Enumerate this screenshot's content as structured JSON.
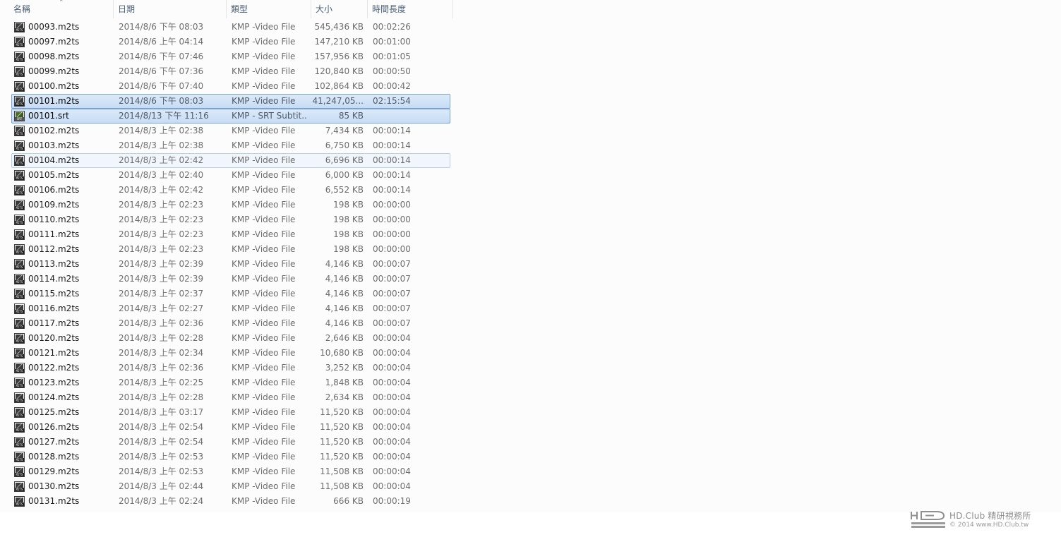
{
  "columns": {
    "name": "名稱",
    "date": "日期",
    "type": "類型",
    "size": "大小",
    "duration": "時間長度"
  },
  "files": [
    {
      "name": "00093.m2ts",
      "date": "2014/8/6 下午 08:03",
      "type": "KMP -Video File",
      "size": "545,436 KB",
      "duration": "00:02:26",
      "icon": "m2ts-file-icon"
    },
    {
      "name": "00097.m2ts",
      "date": "2014/8/6 上午 04:14",
      "type": "KMP -Video File",
      "size": "147,210 KB",
      "duration": "00:01:00",
      "icon": "m2ts-file-icon"
    },
    {
      "name": "00098.m2ts",
      "date": "2014/8/6 下午 07:46",
      "type": "KMP -Video File",
      "size": "157,956 KB",
      "duration": "00:01:05",
      "icon": "m2ts-file-icon"
    },
    {
      "name": "00099.m2ts",
      "date": "2014/8/6 下午 07:36",
      "type": "KMP -Video File",
      "size": "120,840 KB",
      "duration": "00:00:50",
      "icon": "m2ts-file-icon"
    },
    {
      "name": "00100.m2ts",
      "date": "2014/8/6 下午 07:40",
      "type": "KMP -Video File",
      "size": "102,864 KB",
      "duration": "00:00:42",
      "icon": "m2ts-file-icon"
    },
    {
      "name": "00101.m2ts",
      "date": "2014/8/6 下午 08:03",
      "type": "KMP -Video File",
      "size": "41,247,05...",
      "duration": "02:15:54",
      "icon": "m2ts-file-icon",
      "state": "selected"
    },
    {
      "name": "00101.srt",
      "date": "2014/8/13 下午 11:16",
      "type": "KMP - SRT Subtit...",
      "size": "85 KB",
      "duration": "",
      "icon": "srt-file-icon",
      "state": "selected"
    },
    {
      "name": "00102.m2ts",
      "date": "2014/8/3 上午 02:38",
      "type": "KMP -Video File",
      "size": "7,434 KB",
      "duration": "00:00:14",
      "icon": "m2ts-file-icon"
    },
    {
      "name": "00103.m2ts",
      "date": "2014/8/3 上午 02:38",
      "type": "KMP -Video File",
      "size": "6,750 KB",
      "duration": "00:00:14",
      "icon": "m2ts-file-icon"
    },
    {
      "name": "00104.m2ts",
      "date": "2014/8/3 上午 02:42",
      "type": "KMP -Video File",
      "size": "6,696 KB",
      "duration": "00:00:14",
      "icon": "m2ts-file-icon",
      "state": "hover"
    },
    {
      "name": "00105.m2ts",
      "date": "2014/8/3 上午 02:40",
      "type": "KMP -Video File",
      "size": "6,000 KB",
      "duration": "00:00:14",
      "icon": "m2ts-file-icon"
    },
    {
      "name": "00106.m2ts",
      "date": "2014/8/3 上午 02:42",
      "type": "KMP -Video File",
      "size": "6,552 KB",
      "duration": "00:00:14",
      "icon": "m2ts-file-icon"
    },
    {
      "name": "00109.m2ts",
      "date": "2014/8/3 上午 02:23",
      "type": "KMP -Video File",
      "size": "198 KB",
      "duration": "00:00:00",
      "icon": "m2ts-file-icon"
    },
    {
      "name": "00110.m2ts",
      "date": "2014/8/3 上午 02:23",
      "type": "KMP -Video File",
      "size": "198 KB",
      "duration": "00:00:00",
      "icon": "m2ts-file-icon"
    },
    {
      "name": "00111.m2ts",
      "date": "2014/8/3 上午 02:23",
      "type": "KMP -Video File",
      "size": "198 KB",
      "duration": "00:00:00",
      "icon": "m2ts-file-icon"
    },
    {
      "name": "00112.m2ts",
      "date": "2014/8/3 上午 02:23",
      "type": "KMP -Video File",
      "size": "198 KB",
      "duration": "00:00:00",
      "icon": "m2ts-file-icon"
    },
    {
      "name": "00113.m2ts",
      "date": "2014/8/3 上午 02:39",
      "type": "KMP -Video File",
      "size": "4,146 KB",
      "duration": "00:00:07",
      "icon": "m2ts-file-icon"
    },
    {
      "name": "00114.m2ts",
      "date": "2014/8/3 上午 02:39",
      "type": "KMP -Video File",
      "size": "4,146 KB",
      "duration": "00:00:07",
      "icon": "m2ts-file-icon"
    },
    {
      "name": "00115.m2ts",
      "date": "2014/8/3 上午 02:37",
      "type": "KMP -Video File",
      "size": "4,146 KB",
      "duration": "00:00:07",
      "icon": "m2ts-file-icon"
    },
    {
      "name": "00116.m2ts",
      "date": "2014/8/3 上午 02:27",
      "type": "KMP -Video File",
      "size": "4,146 KB",
      "duration": "00:00:07",
      "icon": "m2ts-file-icon"
    },
    {
      "name": "00117.m2ts",
      "date": "2014/8/3 上午 02:36",
      "type": "KMP -Video File",
      "size": "4,146 KB",
      "duration": "00:00:07",
      "icon": "m2ts-file-icon"
    },
    {
      "name": "00120.m2ts",
      "date": "2014/8/3 上午 02:28",
      "type": "KMP -Video File",
      "size": "2,646 KB",
      "duration": "00:00:04",
      "icon": "m2ts-file-icon"
    },
    {
      "name": "00121.m2ts",
      "date": "2014/8/3 上午 02:34",
      "type": "KMP -Video File",
      "size": "10,680 KB",
      "duration": "00:00:04",
      "icon": "m2ts-file-icon"
    },
    {
      "name": "00122.m2ts",
      "date": "2014/8/3 上午 02:36",
      "type": "KMP -Video File",
      "size": "3,252 KB",
      "duration": "00:00:04",
      "icon": "m2ts-file-icon"
    },
    {
      "name": "00123.m2ts",
      "date": "2014/8/3 上午 02:25",
      "type": "KMP -Video File",
      "size": "1,848 KB",
      "duration": "00:00:04",
      "icon": "m2ts-file-icon"
    },
    {
      "name": "00124.m2ts",
      "date": "2014/8/3 上午 02:28",
      "type": "KMP -Video File",
      "size": "2,634 KB",
      "duration": "00:00:04",
      "icon": "m2ts-file-icon"
    },
    {
      "name": "00125.m2ts",
      "date": "2014/8/3 上午 03:17",
      "type": "KMP -Video File",
      "size": "11,520 KB",
      "duration": "00:00:04",
      "icon": "m2ts-file-icon"
    },
    {
      "name": "00126.m2ts",
      "date": "2014/8/3 上午 02:54",
      "type": "KMP -Video File",
      "size": "11,520 KB",
      "duration": "00:00:04",
      "icon": "m2ts-file-icon"
    },
    {
      "name": "00127.m2ts",
      "date": "2014/8/3 上午 02:54",
      "type": "KMP -Video File",
      "size": "11,520 KB",
      "duration": "00:00:04",
      "icon": "m2ts-file-icon"
    },
    {
      "name": "00128.m2ts",
      "date": "2014/8/3 上午 02:53",
      "type": "KMP -Video File",
      "size": "11,520 KB",
      "duration": "00:00:04",
      "icon": "m2ts-file-icon"
    },
    {
      "name": "00129.m2ts",
      "date": "2014/8/3 上午 02:53",
      "type": "KMP -Video File",
      "size": "11,508 KB",
      "duration": "00:00:04",
      "icon": "m2ts-file-icon"
    },
    {
      "name": "00130.m2ts",
      "date": "2014/8/3 上午 02:44",
      "type": "KMP -Video File",
      "size": "11,508 KB",
      "duration": "00:00:04",
      "icon": "m2ts-file-icon"
    },
    {
      "name": "00131.m2ts",
      "date": "2014/8/3 上午 02:24",
      "type": "KMP -Video File",
      "size": "666 KB",
      "duration": "00:00:19",
      "icon": "m2ts-file-icon"
    }
  ],
  "icon_bands": {
    "m2ts": "M2TS",
    "srt": "SRT"
  },
  "watermark": {
    "line1": "HD.Club 精研視務所",
    "line2": "© 2014  www.HD.Club.tw"
  },
  "colors": {
    "selection_fill": "#c6dcf5",
    "selection_border": "#7da2ce",
    "header_text": "#4c607a",
    "secondary_text": "#6d6d6d"
  }
}
